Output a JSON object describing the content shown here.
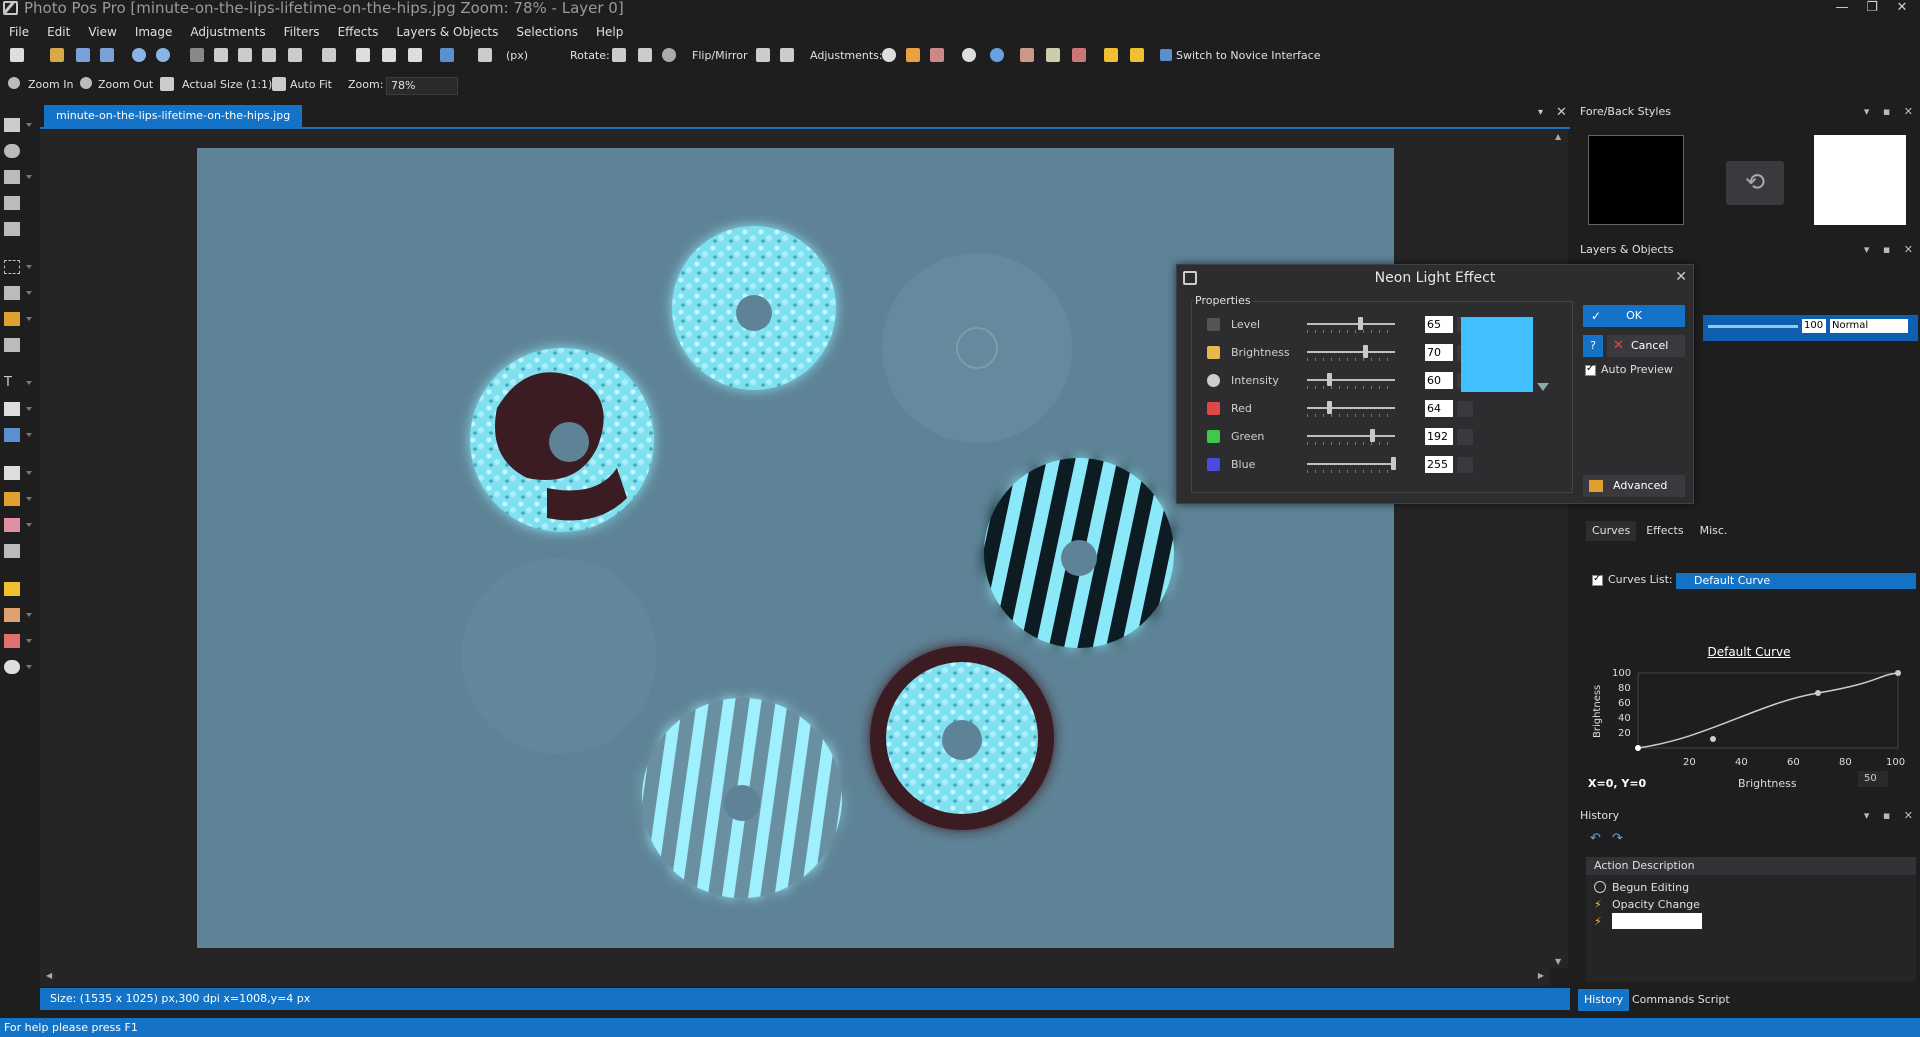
{
  "window": {
    "title": "Photo Pos Pro [minute-on-the-lips-lifetime-on-the-hips.jpg Zoom: 78% - Layer 0]"
  },
  "menu": [
    "File",
    "Edit",
    "View",
    "Image",
    "Adjustments",
    "Filters",
    "Effects",
    "Layers & Objects",
    "Selections",
    "Help"
  ],
  "toolbar": {
    "units": "(px)",
    "rotate_label": "Rotate:",
    "flip_label": "Flip/Mirror",
    "adjust_label": "Adjustments:",
    "novice_label": "Switch to Novice Interface"
  },
  "zoombar": {
    "zoom_in": "Zoom In",
    "zoom_out": "Zoom Out",
    "actual_size": "Actual Size (1:1)",
    "auto_fit": "Auto Fit",
    "zoom_label": "Zoom:",
    "zoom_value": "78%"
  },
  "document": {
    "tab": "minute-on-the-lips-lifetime-on-the-hips.jpg",
    "status": "Size: (1535 x 1025) px,300 dpi   x=1008,y=4 px"
  },
  "help_status": "For help please press F1",
  "dialog": {
    "title": "Neon Light Effect",
    "properties_legend": "Properties",
    "rows": [
      {
        "label": "Level",
        "value": "65",
        "icon_color": "#555555",
        "fraction": 0.62
      },
      {
        "label": "Brightness",
        "value": "70",
        "icon_color": "#e8b84a",
        "fraction": 0.68
      },
      {
        "label": "Intensity",
        "value": "60",
        "icon_color": "#cccccc",
        "fraction": 0.25
      },
      {
        "label": "Red",
        "value": "64",
        "icon_color": "#e04848",
        "fraction": 0.25
      },
      {
        "label": "Green",
        "value": "192",
        "icon_color": "#3dc94a",
        "fraction": 0.75
      },
      {
        "label": "Blue",
        "value": "255",
        "icon_color": "#4b4be0",
        "fraction": 1.0
      }
    ],
    "preview_color": "#40c0ff",
    "ok": "OK",
    "help": "?",
    "cancel": "Cancel",
    "auto_preview": "Auto Preview",
    "advanced": "Advanced"
  },
  "panels": {
    "fore_back": "Fore/Back Styles",
    "layers": "Layers & Objects",
    "layer_opacity": "100",
    "layer_blend": "Normal",
    "tabs": [
      "Curves",
      "Effects",
      "Misc."
    ],
    "curves_list_label": "Curves List:",
    "curves_list_value": "Default Curve",
    "curve_title": "Default Curve",
    "curve_axis_y": "Brightness",
    "curve_axis_x": "Brightness",
    "curve_y_ticks": [
      "100",
      "80",
      "60",
      "40",
      "20"
    ],
    "curve_x_ticks": [
      "20",
      "40",
      "60",
      "80",
      "100"
    ],
    "curve_xy": "X=0, Y=0",
    "curve_value": "50",
    "history": "History",
    "history_header": "Action Description",
    "history_items": [
      "Begun Editing",
      "Opacity Change"
    ],
    "bottom_tabs": [
      "History",
      "Commands Script"
    ]
  }
}
